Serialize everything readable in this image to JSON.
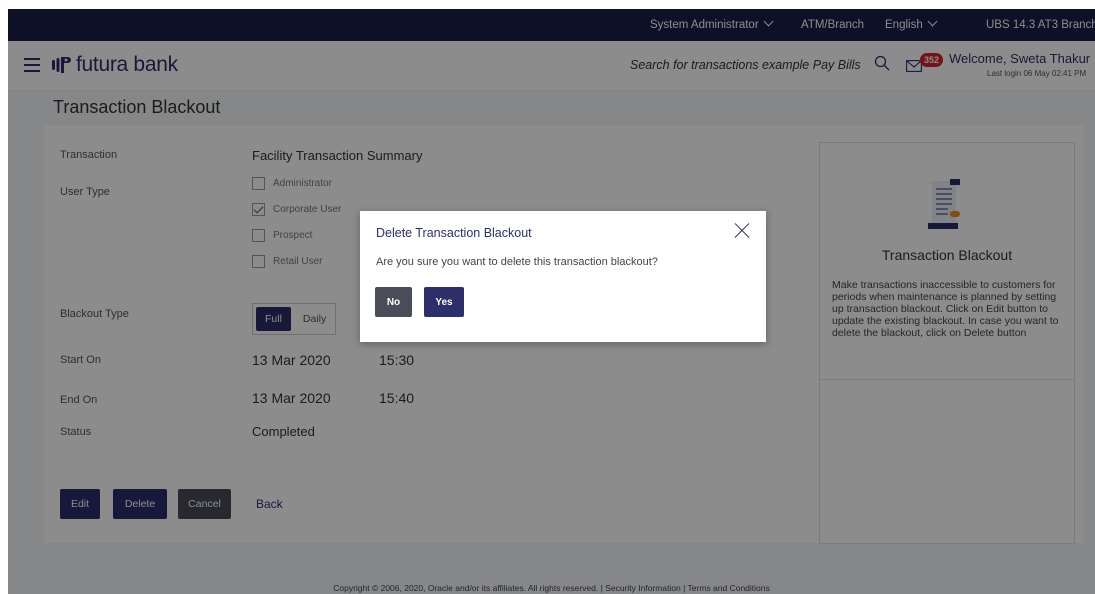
{
  "topbar": {
    "role": "System Administrator",
    "atm_branch": "ATM/Branch",
    "language": "English",
    "entity": "UBS 14.3 AT3 Branch"
  },
  "header": {
    "brand": "futura bank",
    "search_placeholder": "Search for transactions example Pay Bills",
    "notifications_count": "352",
    "welcome": "Welcome, Sweta Thakur",
    "last_login": "Last login 06 May 02:41 PM"
  },
  "page": {
    "title": "Transaction Blackout"
  },
  "form": {
    "transaction_label": "Transaction",
    "transaction_value": "Facility Transaction Summary",
    "user_type_label": "User Type",
    "user_types": [
      {
        "label": "Administrator",
        "checked": false
      },
      {
        "label": "Corporate User",
        "checked": true
      },
      {
        "label": "Prospect",
        "checked": false
      },
      {
        "label": "Retail User",
        "checked": false
      }
    ],
    "blackout_type_label": "Blackout Type",
    "blackout_types": [
      "Full",
      "Daily"
    ],
    "blackout_type_selected": "Full",
    "start_on_label": "Start On",
    "start_date": "13 Mar 2020",
    "start_time": "15:30",
    "end_on_label": "End On",
    "end_date": "13 Mar 2020",
    "end_time": "15:40",
    "status_label": "Status",
    "status_value": "Completed"
  },
  "actions": {
    "edit": "Edit",
    "delete": "Delete",
    "cancel": "Cancel",
    "back": "Back"
  },
  "help_card": {
    "title": "Transaction Blackout",
    "description": "Make transactions inaccessible to customers for periods when maintenance is planned by setting up transaction blackout. Click on Edit button to update the existing blackout. In case you want to delete the blackout, click on Delete button"
  },
  "footer": {
    "text": "Copyright © 2006, 2020, Oracle and/or its affiliates. All rights reserved. | Security Information | Terms and Conditions"
  },
  "modal": {
    "title": "Delete Transaction Blackout",
    "message": "Are you sure you want to delete this transaction blackout?",
    "no": "No",
    "yes": "Yes"
  },
  "colors": {
    "navy": "#2d2f6b",
    "topbar": "#1a1e4a",
    "badge": "#d9232d"
  }
}
